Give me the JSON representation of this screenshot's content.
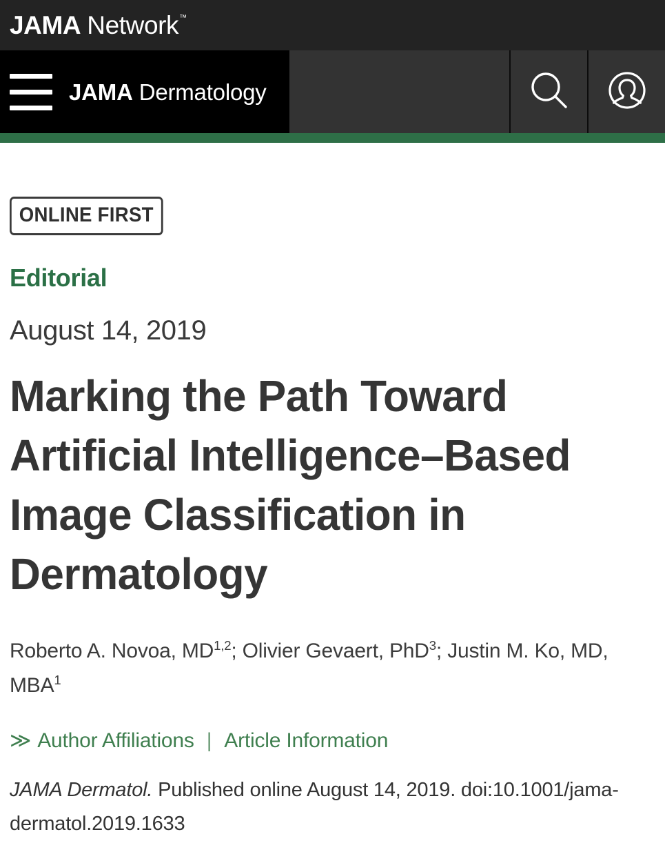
{
  "brand": {
    "name_bold": "JAMA",
    "name_light": "Network",
    "trademark": "™"
  },
  "nav": {
    "menu_icon": "hamburger-menu-icon",
    "journal_bold": "JAMA",
    "journal_regular": "Dermatology",
    "search_icon": "search-icon",
    "account_icon": "user-account-icon",
    "accent_color": "#2e6f47",
    "bar_color": "#333333",
    "journal_block_color": "#000000",
    "brand_strip_color": "#232323"
  },
  "article": {
    "badge": "ONLINE FIRST",
    "section_label": "Editorial",
    "section_color": "#2b7046",
    "date": "August 14, 2019",
    "title": "Marking the Path Toward Artificial Intelligence–Based Image Classification in Dermatology",
    "authors": [
      {
        "name": "Roberto A. Novoa, MD",
        "affiliations": "1,2",
        "separator": "; "
      },
      {
        "name": "Olivier Gevaert, PhD",
        "affiliations": "3",
        "separator": "; "
      },
      {
        "name": "Justin M. Ko, MD, MBA",
        "affiliations": "1",
        "separator": ""
      }
    ],
    "links": {
      "chevron_icon": "≫",
      "author_affiliations": "Author Affiliations",
      "separator": "|",
      "article_information": "Article Information",
      "link_color": "#3f7f4f"
    },
    "citation": {
      "journal": "JAMA Dermatol.",
      "rest": " Published online August 14, 2019. doi:10.1001/jama-dermatol.2019.1633"
    }
  }
}
